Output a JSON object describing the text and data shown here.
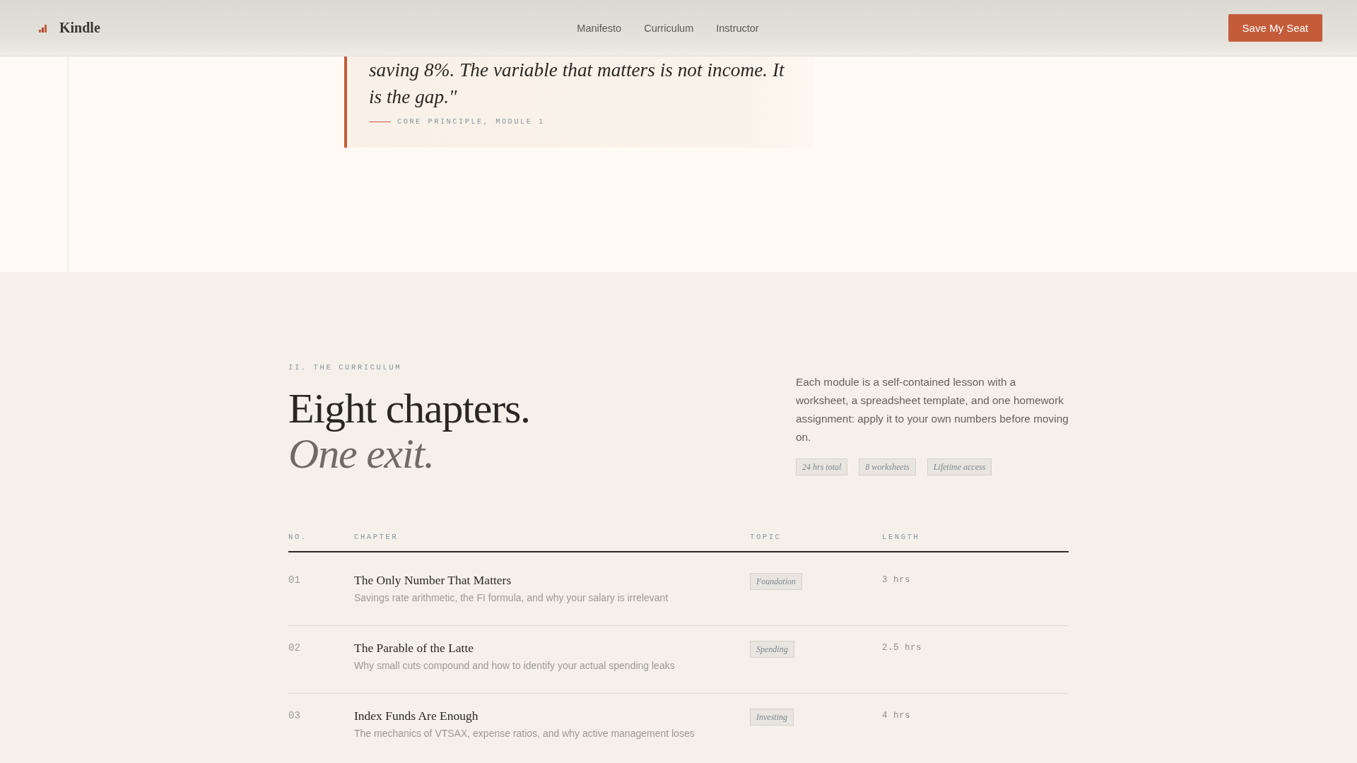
{
  "header": {
    "logo": "Kindle",
    "nav": [
      {
        "label": "Manifesto"
      },
      {
        "label": "Curriculum"
      },
      {
        "label": "Instructor"
      }
    ],
    "cta": "Save My Seat"
  },
  "quote": {
    "text": "saving 8%. The variable that matters is not income. It is the gap.\"",
    "attribution": "CORE PRINCIPLE, MODULE 1"
  },
  "curriculum": {
    "eyebrow": "II. THE CURRICULUM",
    "heading": "Eight chapters.",
    "heading_italic": "One exit.",
    "intro": "Each module is a self-contained lesson with a worksheet, a spreadsheet template, and one homework assignment: apply it to your own numbers before moving on.",
    "tags": [
      "24 hrs total",
      "8 worksheets",
      "Lifetime access"
    ],
    "table": {
      "columns": [
        "NO.",
        "CHAPTER",
        "TOPIC",
        "LENGTH"
      ],
      "rows": [
        {
          "no": "01",
          "title": "The Only Number That Matters",
          "description": "Savings rate arithmetic, the FI formula, and why your salary is irrelevant",
          "topic": "Foundation",
          "length": "3 hrs"
        },
        {
          "no": "02",
          "title": "The Parable of the Latte",
          "description": "Why small cuts compound and how to identify your actual spending leaks",
          "topic": "Spending",
          "length": "2.5 hrs"
        },
        {
          "no": "03",
          "title": "Index Funds Are Enough",
          "description": "The mechanics of VTSAX, expense ratios, and why active management loses",
          "topic": "Investing",
          "length": "4 hrs"
        }
      ]
    }
  }
}
